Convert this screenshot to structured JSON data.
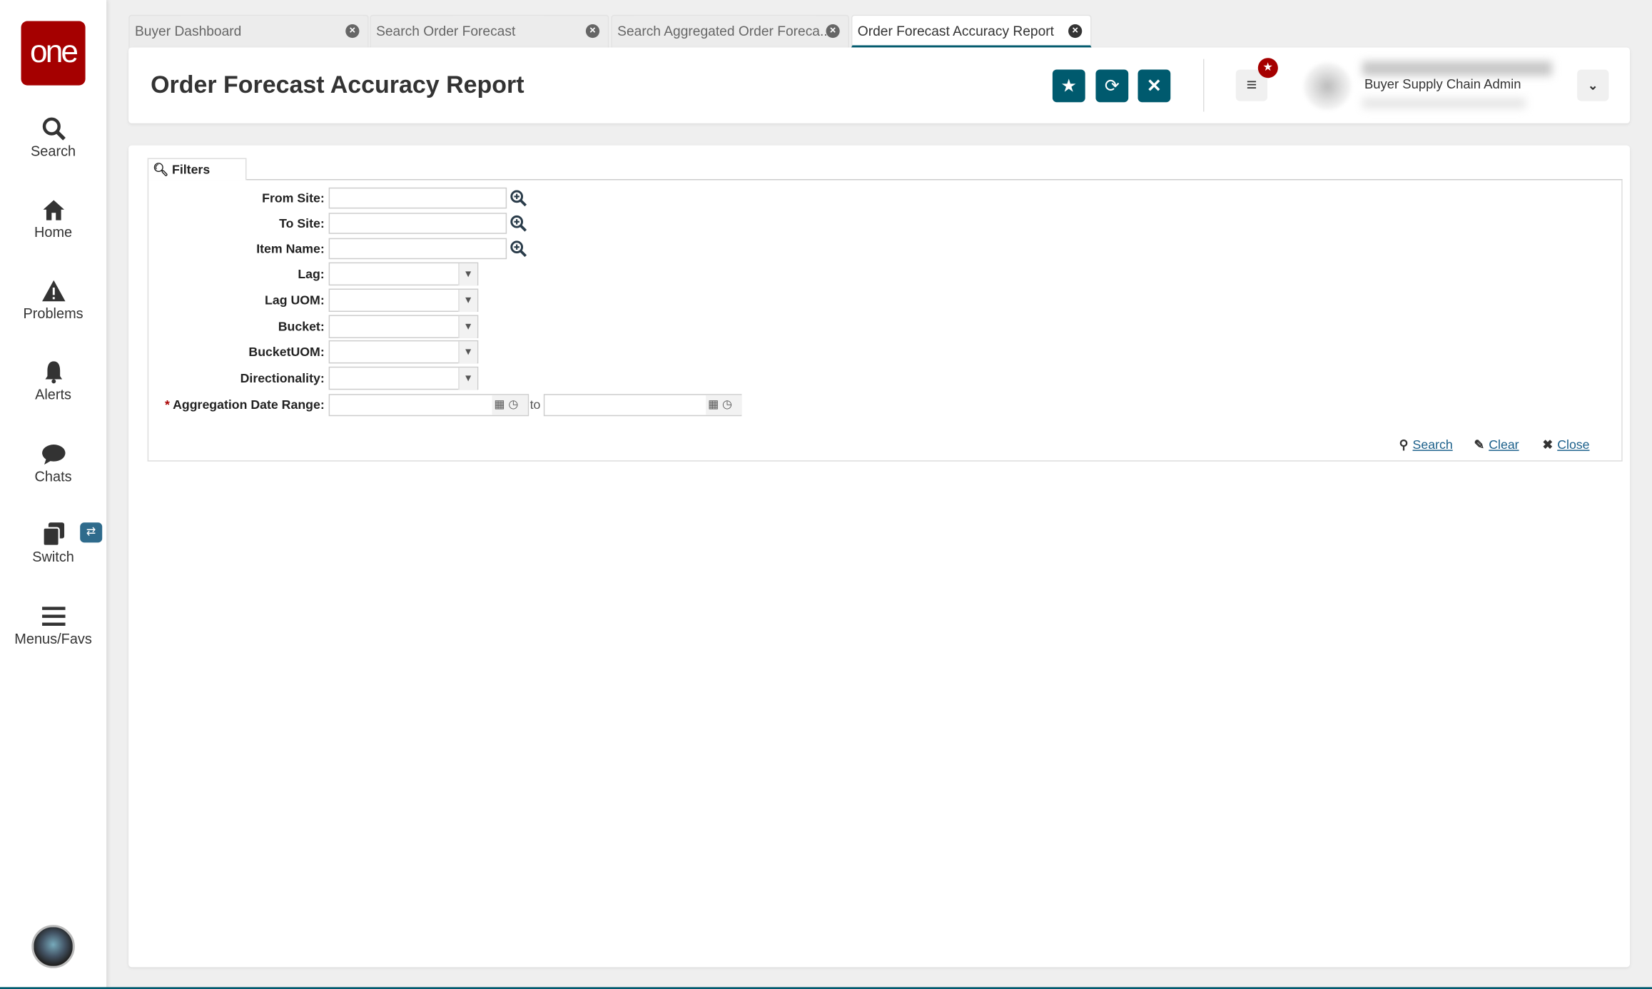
{
  "sidebar": {
    "logo": "one",
    "items": [
      {
        "label": "Search",
        "icon": "search-icon"
      },
      {
        "label": "Home",
        "icon": "home-icon"
      },
      {
        "label": "Problems",
        "icon": "warning-icon"
      },
      {
        "label": "Alerts",
        "icon": "bell-icon"
      },
      {
        "label": "Chats",
        "icon": "chat-icon"
      },
      {
        "label": "Switch",
        "icon": "switch-icon"
      },
      {
        "label": "Menus/Favs",
        "icon": "menu-icon"
      }
    ]
  },
  "tabs": [
    {
      "label": "Buyer Dashboard"
    },
    {
      "label": "Search Order Forecast"
    },
    {
      "label": "Search Aggregated Order Foreca..."
    },
    {
      "label": "Order Forecast Accuracy Report",
      "active": true
    }
  ],
  "header": {
    "title": "Order Forecast Accuracy Report",
    "user_role": "Buyer Supply Chain Admin"
  },
  "filters": {
    "tab_label": "Filters",
    "fields": {
      "from_site": "From Site:",
      "to_site": "To Site:",
      "item_name": "Item Name:",
      "lag": "Lag:",
      "lag_uom": "Lag UOM:",
      "bucket": "Bucket:",
      "bucket_uom": "BucketUOM:",
      "directionality": "Directionality:",
      "date_range": "Aggregation Date Range:",
      "required_mark": "*",
      "to": "to"
    },
    "values": {
      "from_site": "",
      "to_site": "",
      "item_name": "",
      "lag": "",
      "lag_uom": "",
      "bucket": "",
      "bucket_uom": "",
      "directionality": "",
      "date_from": "",
      "date_to": ""
    },
    "actions": {
      "search": "Search",
      "clear": "Clear",
      "close": "Close"
    }
  },
  "colors": {
    "accent": "#005a6e",
    "brand": "#a50000"
  }
}
